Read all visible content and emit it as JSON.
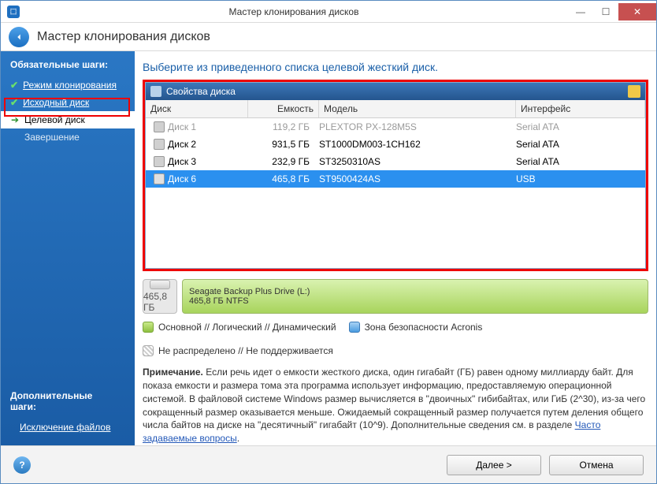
{
  "titlebar": {
    "title": "Мастер клонирования дисков"
  },
  "header": {
    "title": "Мастер клонирования дисков"
  },
  "sidebar": {
    "heading": "Обязательные шаги:",
    "items": [
      {
        "label": "Режим клонирования",
        "type": "done"
      },
      {
        "label": "Исходный диск",
        "type": "done"
      },
      {
        "label": "Целевой диск",
        "type": "current"
      },
      {
        "label": "Завершение",
        "type": "plain"
      }
    ],
    "extra_heading": "Дополнительные шаги:",
    "extra_item": "Исключение файлов"
  },
  "main": {
    "title": "Выберите из приведенного списка целевой жесткий диск.",
    "panel_title": "Свойства диска",
    "columns": {
      "disk": "Диск",
      "cap": "Емкость",
      "model": "Модель",
      "iface": "Интерфейс"
    },
    "rows": [
      {
        "disk": "Диск 1",
        "cap": "119,2 ГБ",
        "model": "PLEXTOR PX-128M5S",
        "iface": "Serial ATA",
        "state": "disabled"
      },
      {
        "disk": "Диск 2",
        "cap": "931,5 ГБ",
        "model": "ST1000DM003-1CH162",
        "iface": "Serial ATA",
        "state": ""
      },
      {
        "disk": "Диск 3",
        "cap": "232,9 ГБ",
        "model": "ST3250310AS",
        "iface": "Serial ATA",
        "state": ""
      },
      {
        "disk": "Диск 6",
        "cap": "465,8 ГБ",
        "model": "ST9500424AS",
        "iface": "USB",
        "state": "sel"
      }
    ],
    "drive": {
      "size": "465,8 ГБ",
      "name": "Seagate Backup Plus Drive (L:)",
      "detail": "465,8 ГБ  NTFS"
    },
    "legend": {
      "primary": "Основной // Логический // Динамический",
      "zone": "Зона безопасности Acronis",
      "unalloc": "Не распределено // Не поддерживается"
    },
    "note_label": "Примечание.",
    "note_body": " Если речь идет о емкости жесткого диска, один гигабайт (ГБ) равен одному миллиарду байт. Для показа емкости и размера тома эта программа использует информацию, предоставляемую операционной системой. В файловой системе Windows размер вычисляется в \"двоичных\" гибибайтах, или ГиБ (2^30), из-за чего сокращенный размер оказывается меньше. Ожидаемый сокращенный размер получается путем деления общего числа байтов на диске на \"десятичный\" гигабайт (10^9). Дополнительные сведения см. в разделе ",
    "note_link": "Часто задаваемые вопросы"
  },
  "footer": {
    "next": "Далее >",
    "cancel": "Отмена"
  }
}
